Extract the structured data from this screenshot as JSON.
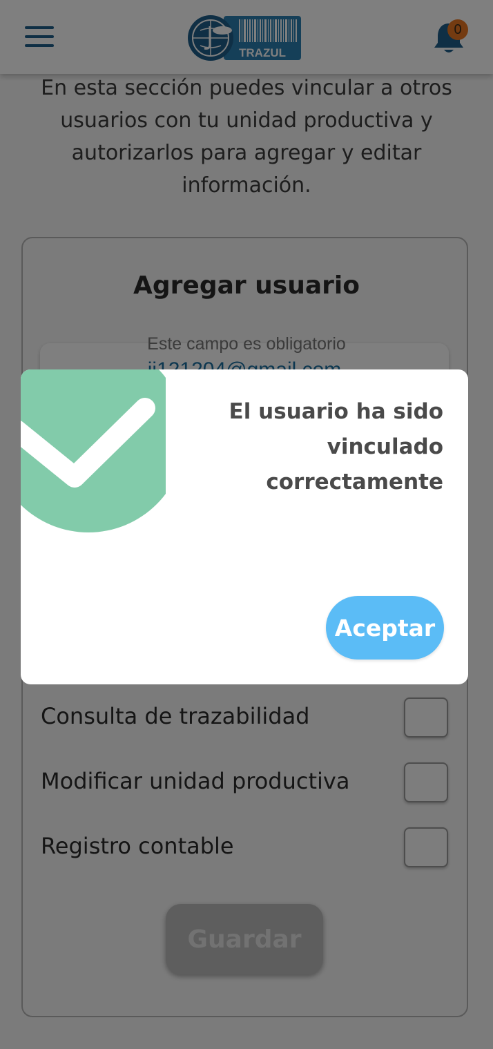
{
  "header": {
    "logo_text": "TRAZUL",
    "notification_count": "0",
    "colors": {
      "primary": "#1f5f8b",
      "badge": "#e87722"
    }
  },
  "intro": {
    "text": "En esta sección puedes vincular a otros usuarios con tu unidad productiva y autorizarlos para agregar y editar información."
  },
  "form": {
    "title": "Agregar usuario",
    "email_hint": "Este campo es obligatorio",
    "email_value": "jj121204@gmail.com",
    "permissions": [
      {
        "label": "Consulta de trazabilidad",
        "checked": false
      },
      {
        "label": "Modificar unidad productiva",
        "checked": false
      },
      {
        "label": "Registro contable",
        "checked": false
      }
    ],
    "save_label": "Guardar"
  },
  "modal": {
    "message_lines": [
      "El usuario ha sido",
      "vinculado",
      "correctamente"
    ],
    "accept_label": "Aceptar",
    "colors": {
      "success": "#82cbaa",
      "accept": "#5bbcf6"
    }
  }
}
